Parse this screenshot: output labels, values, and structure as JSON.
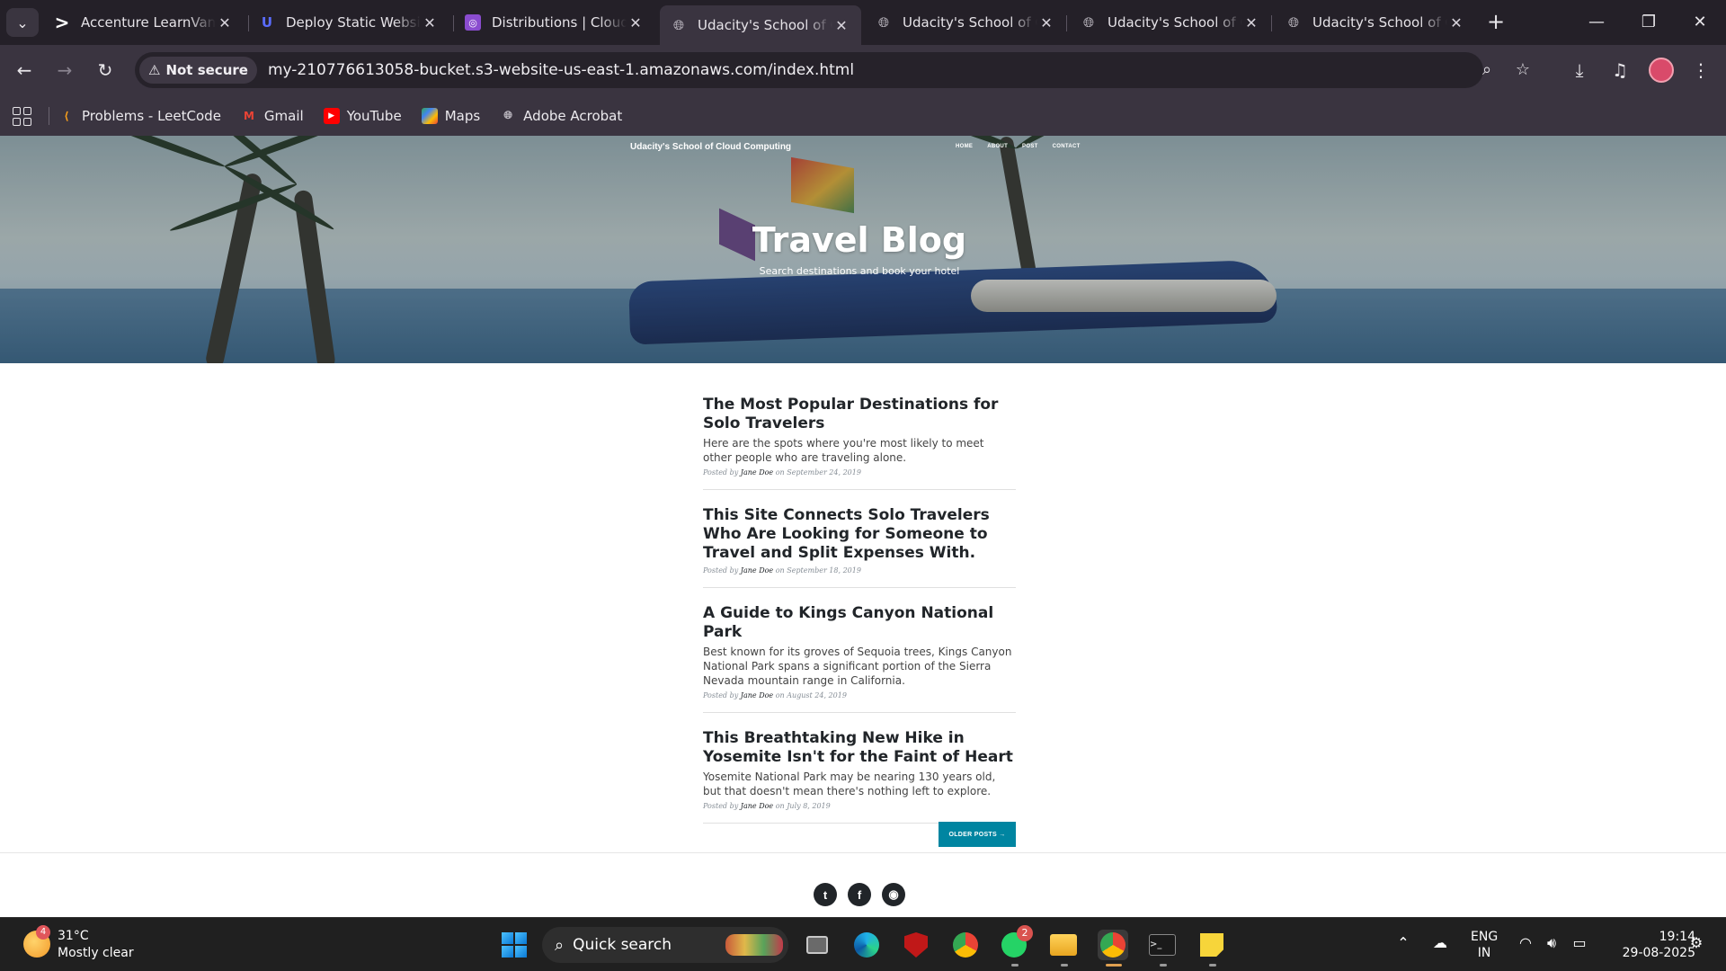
{
  "browser": {
    "tabs": [
      {
        "title": "Accenture LearnVantage",
        "active": false
      },
      {
        "title": "Deploy Static Website",
        "active": false
      },
      {
        "title": "Distributions | CloudFront",
        "active": false
      },
      {
        "title": "Udacity's School of Cloud Computing",
        "active": true
      },
      {
        "title": "Udacity's School of Cloud Computing",
        "active": false
      },
      {
        "title": "Udacity's School of Cloud Computing",
        "active": false
      },
      {
        "title": "Udacity's School of Cloud Computing",
        "active": false
      }
    ],
    "security_label": "Not secure",
    "url": "my-210776613058-bucket.s3-website-us-east-1.amazonaws.com/index.html",
    "bookmarks": [
      {
        "label": "Problems - LeetCode",
        "icon": "leetcode-icon",
        "color": "#f89f1b"
      },
      {
        "label": "Gmail",
        "icon": "gmail-icon",
        "color": "#ea4335"
      },
      {
        "label": "YouTube",
        "icon": "youtube-icon",
        "color": "#ff0000"
      },
      {
        "label": "Maps",
        "icon": "maps-icon",
        "color": "#34a853"
      },
      {
        "label": "Adobe Acrobat",
        "icon": "globe-icon",
        "color": "#bcb8c0"
      }
    ]
  },
  "site": {
    "brand": "Udacity's School of Cloud Computing",
    "nav": [
      "HOME",
      "ABOUT",
      "POST",
      "CONTACT"
    ],
    "hero_title": "Travel Blog",
    "hero_subtitle": "Search destinations and book your hotel",
    "posts": [
      {
        "title": "The Most Popular Destinations for Solo Travelers",
        "subtitle": "Here are the spots where you're most likely to meet other people who are traveling alone.",
        "meta_prefix": "Posted by",
        "author": "Jane Doe",
        "date": "on September 24, 2019"
      },
      {
        "title": "This Site Connects Solo Travelers Who Are Looking for Someone to Travel and Split Expenses With.",
        "subtitle": "",
        "meta_prefix": "Posted by",
        "author": "Jane Doe",
        "date": "on September 18, 2019"
      },
      {
        "title": "A Guide to Kings Canyon National Park",
        "subtitle": "Best known for its groves of Sequoia trees, Kings Canyon National Park spans a significant portion of the Sierra Nevada mountain range in California.",
        "meta_prefix": "Posted by",
        "author": "Jane Doe",
        "date": "on August 24, 2019"
      },
      {
        "title": "This Breathtaking New Hike in Yosemite Isn't for the Faint of Heart",
        "subtitle": "Yosemite National Park may be nearing 130 years old, but that doesn't mean there's nothing left to explore.",
        "meta_prefix": "Posted by",
        "author": "Jane Doe",
        "date": "on July 8, 2019"
      }
    ],
    "older_posts": "OLDER POSTS →",
    "accent_color": "#0085a1",
    "social": [
      {
        "name": "twitter-icon",
        "glyph": "t"
      },
      {
        "name": "facebook-icon",
        "glyph": "f"
      },
      {
        "name": "github-icon",
        "glyph": "◉"
      }
    ]
  },
  "taskbar": {
    "weather_temp": "31°C",
    "weather_desc": "Mostly clear",
    "weather_badge": "4",
    "search_placeholder": "Quick search",
    "whatsapp_badge": "2",
    "language": "ENG",
    "region": "IN",
    "time": "19:14",
    "date": "29-08-2025"
  }
}
